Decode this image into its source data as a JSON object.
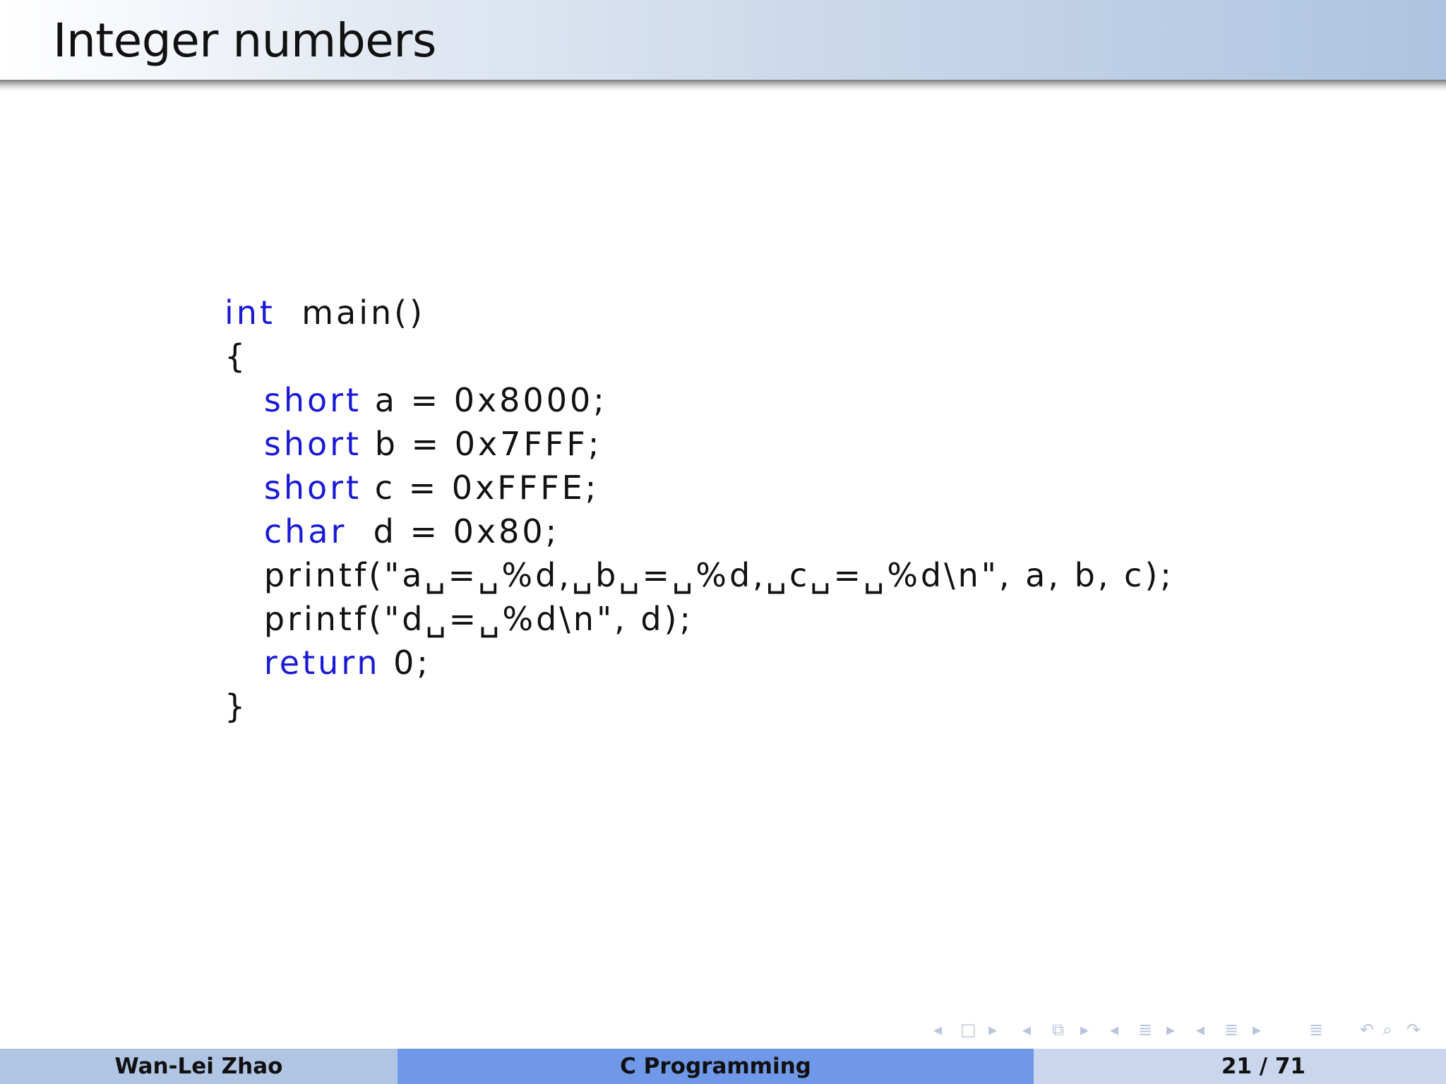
{
  "slide": {
    "title": "Integer numbers"
  },
  "code": {
    "lines": [
      {
        "indent": "",
        "kw": "int",
        "sep": "  ",
        "rest": "main()"
      },
      {
        "indent": "",
        "kw": "",
        "sep": "",
        "rest": "{"
      },
      {
        "indent": "   ",
        "kw": "short",
        "sep": " ",
        "rest": "a = 0x8000;"
      },
      {
        "indent": "   ",
        "kw": "short",
        "sep": " ",
        "rest": "b = 0x7FFF;"
      },
      {
        "indent": "   ",
        "kw": "short",
        "sep": " ",
        "rest": "c = 0xFFFE;"
      },
      {
        "indent": "   ",
        "kw": "char",
        "sep": "  ",
        "rest": "d = 0x80;"
      },
      {
        "indent": "   ",
        "kw": "",
        "sep": "",
        "rest": "printf(\"a␣=␣%d,␣b␣=␣%d,␣c␣=␣%d\\n\", a, b, c);"
      },
      {
        "indent": "   ",
        "kw": "",
        "sep": "",
        "rest": "printf(\"d␣=␣%d\\n\", d);"
      },
      {
        "indent": "   ",
        "kw": "return",
        "sep": " ",
        "rest": "0;"
      },
      {
        "indent": "",
        "kw": "",
        "sep": "",
        "rest": "}"
      }
    ]
  },
  "navigation": {
    "icons": [
      {
        "name": "nav-prev-frame-icon",
        "glyph": "◂"
      },
      {
        "name": "nav-frame-icon",
        "glyph": "□"
      },
      {
        "name": "nav-next-frame-icon",
        "glyph": "▸"
      },
      {
        "name": "nav-prev-subsection-icon",
        "glyph": "◂"
      },
      {
        "name": "nav-subsection-icon",
        "glyph": "⧉"
      },
      {
        "name": "nav-next-subsection-icon",
        "glyph": "▸"
      },
      {
        "name": "nav-prev-section-icon",
        "glyph": "◂"
      },
      {
        "name": "nav-section-icon",
        "glyph": "≣"
      },
      {
        "name": "nav-next-section-icon",
        "glyph": "▸"
      },
      {
        "name": "nav-prev-part-icon",
        "glyph": "◂"
      },
      {
        "name": "nav-part-icon",
        "glyph": "≣"
      },
      {
        "name": "nav-next-part-icon",
        "glyph": "▸"
      },
      {
        "name": "nav-document-icon",
        "glyph": "≣"
      },
      {
        "name": "nav-back-icon",
        "glyph": "↶"
      },
      {
        "name": "nav-search-icon",
        "glyph": "⌕"
      },
      {
        "name": "nav-forward-icon",
        "glyph": "↷"
      }
    ]
  },
  "footer": {
    "author": "Wan-Lei Zhao",
    "course": "C Programming",
    "page": "21 / 71"
  }
}
